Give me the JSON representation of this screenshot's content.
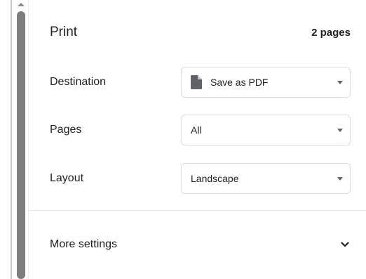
{
  "header": {
    "title": "Print",
    "page_count": "2 pages"
  },
  "settings": {
    "destination": {
      "label": "Destination",
      "value": "Save as PDF",
      "icon": "file-icon"
    },
    "pages": {
      "label": "Pages",
      "value": "All"
    },
    "layout": {
      "label": "Layout",
      "value": "Landscape"
    }
  },
  "more_settings": {
    "label": "More settings",
    "icon": "chevron-down-icon"
  },
  "colors": {
    "text": "#202124",
    "border": "#dadce0",
    "icon": "#5f6368",
    "scrollbar_thumb": "#7d7d7d"
  }
}
